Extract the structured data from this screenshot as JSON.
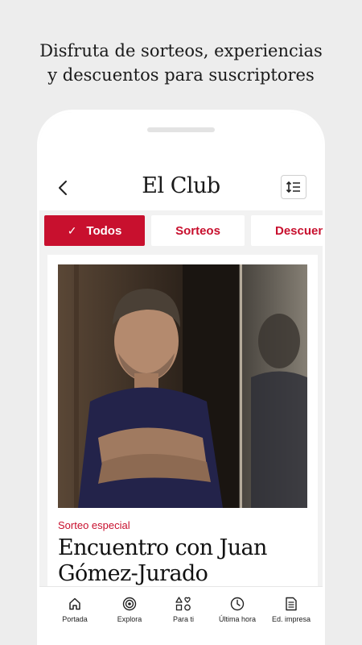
{
  "promo": {
    "line1": "Disfruta de sorteos, experiencias",
    "line2": "y descuentos para suscriptores"
  },
  "app": {
    "title": "El Club",
    "back_icon": "chevron-left-icon",
    "sort_icon": "sort-icon"
  },
  "tabs": [
    {
      "label": "Todos",
      "active": true,
      "icon": "check-icon"
    },
    {
      "label": "Sorteos",
      "active": false
    },
    {
      "label": "Descuentos",
      "active": false
    }
  ],
  "article": {
    "category": "Sorteo especial",
    "title": "Encuentro con Juan Gómez-Jurado",
    "image": "portrait-photo"
  },
  "nav": [
    {
      "label": "Portada",
      "icon": "home-icon"
    },
    {
      "label": "Explora",
      "icon": "explore-icon"
    },
    {
      "label": "Para ti",
      "icon": "shapes-icon"
    },
    {
      "label": "Última hora",
      "icon": "clock-icon"
    },
    {
      "label": "Ed. impresa",
      "icon": "newspaper-icon"
    }
  ],
  "colors": {
    "accent": "#c8102e",
    "background": "#ededed",
    "card": "#ffffff"
  }
}
